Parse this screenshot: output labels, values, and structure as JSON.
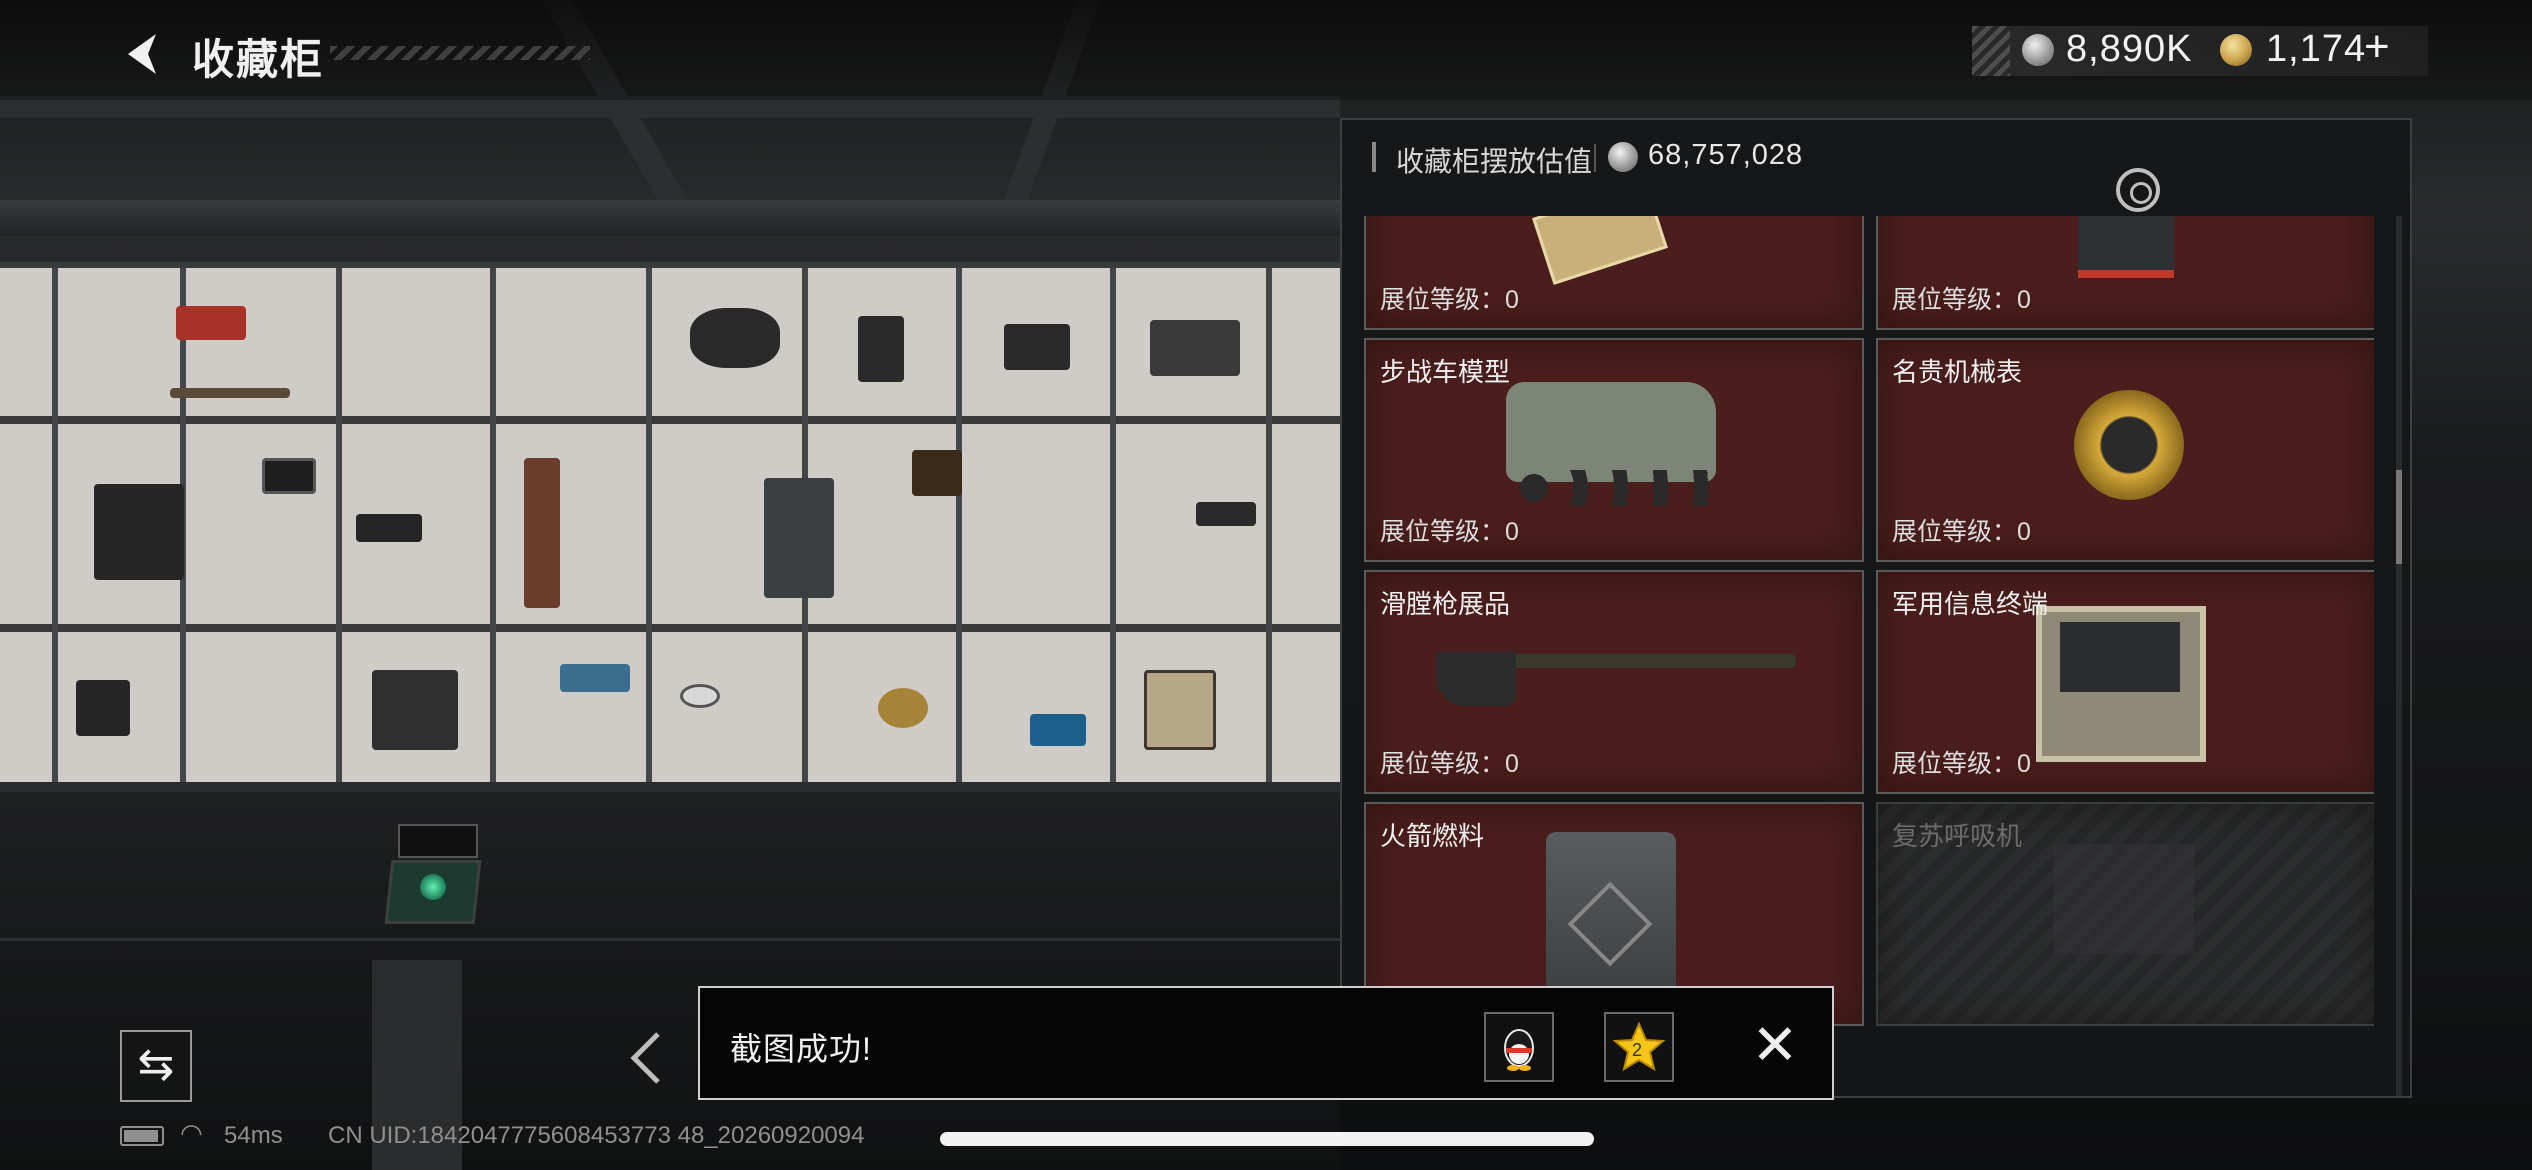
{
  "header": {
    "back_icon": "chevron-left-icon",
    "title": "收藏柜"
  },
  "currencies": {
    "silver": {
      "icon": "silver-coin-icon",
      "value": "8,890K"
    },
    "gold": {
      "icon": "gold-coin-icon",
      "value": "1,174"
    },
    "add_label": "+"
  },
  "panel": {
    "label": "收藏柜摆放估值",
    "value": "68,757,028",
    "cards": [
      {
        "name": "",
        "level": "展位等级：0",
        "locked": false
      },
      {
        "name": "",
        "level": "展位等级：0",
        "locked": false
      },
      {
        "name": "步战车模型",
        "level": "展位等级：0",
        "locked": false
      },
      {
        "name": "名贵机械表",
        "level": "展位等级：0",
        "locked": false
      },
      {
        "name": "滑膛枪展品",
        "level": "展位等级：0",
        "locked": false
      },
      {
        "name": "军用信息终端",
        "level": "展位等级：0",
        "locked": false
      },
      {
        "name": "火箭燃料",
        "level": "",
        "locked": false
      },
      {
        "name": "复苏呼吸机",
        "level": "",
        "locked": true
      }
    ]
  },
  "toast": {
    "message": "截图成功!",
    "qq_icon": "qq-icon",
    "qzone_icon": "qzone-icon",
    "close_label": "✕"
  },
  "status_bar": {
    "ping": "54ms",
    "uid": "CN UID:1842047775608453773 48_20260920094"
  },
  "colors": {
    "card_bg": "#4a1e1c",
    "panel_bg": "#161718",
    "accent_text": "#f0f0f0"
  }
}
